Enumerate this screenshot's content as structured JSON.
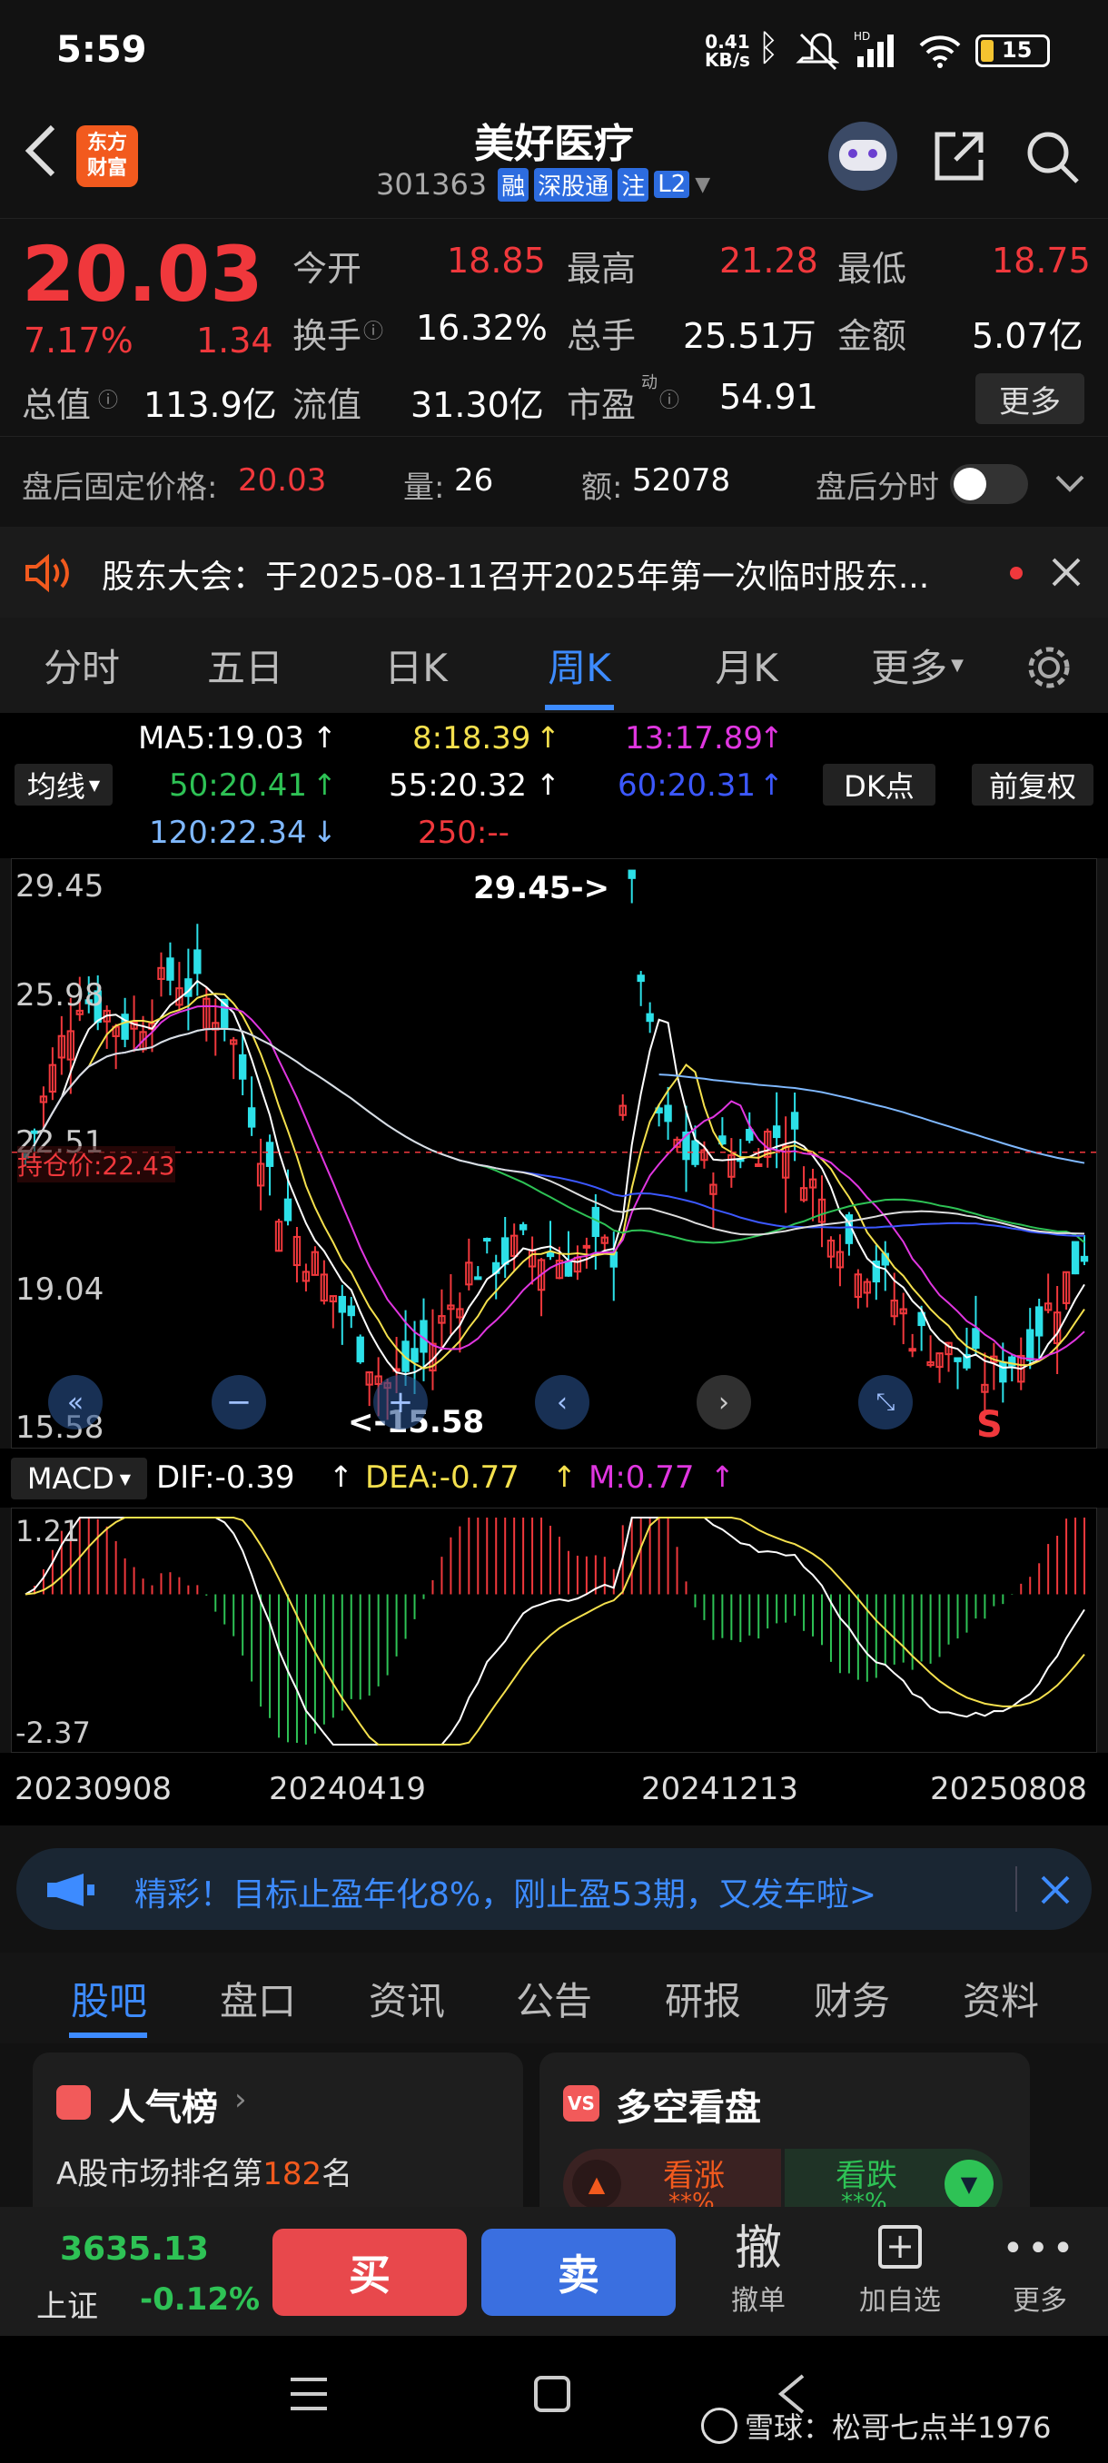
{
  "status": {
    "time": "5:59",
    "net_speed_top": "0.41",
    "net_speed_unit": "KB/s",
    "battery": "15"
  },
  "header": {
    "logo_line1": "东方",
    "logo_line2": "财富",
    "name": "美好医疗",
    "code": "301363",
    "tags": [
      "融",
      "深股通",
      "注",
      "L2"
    ]
  },
  "quote": {
    "price": "20.03",
    "pct": "7.17%",
    "change": "1.34",
    "rows": [
      [
        {
          "label": "今开",
          "value": "18.85",
          "color": "red"
        },
        {
          "label": "最高",
          "value": "21.28",
          "color": "red"
        },
        {
          "label": "最低",
          "value": "18.75",
          "color": "red"
        }
      ],
      [
        {
          "label": "换手",
          "value": "16.32%",
          "color": "white"
        },
        {
          "label": "总手",
          "value": "25.51万",
          "color": "white"
        },
        {
          "label": "金额",
          "value": "5.07亿",
          "color": "white"
        }
      ],
      [
        {
          "label": "总值",
          "value": "113.9亿",
          "color": "white"
        },
        {
          "label": "流值",
          "value": "31.30亿",
          "color": "white"
        },
        {
          "label": "市盈",
          "value": "54.91",
          "color": "white"
        }
      ]
    ],
    "more": "更多",
    "pe_superscript": "动"
  },
  "afterhours": {
    "fixed_label": "盘后固定价格:",
    "fixed_value": "20.03",
    "vol_label": "量:",
    "vol_value": "26",
    "amt_label": "额:",
    "amt_value": "52078",
    "toggle_label": "盘后分时"
  },
  "notice": {
    "text": "股东大会：于2025-08-11召开2025年第一次临时股东..."
  },
  "tabs": [
    "分时",
    "五日",
    "日K",
    "周K",
    "月K",
    "更多"
  ],
  "active_tab": 3,
  "ma": {
    "ma5": "MA5:19.03",
    "ma8": "8:18.39",
    "ma13": "13:17.89",
    "ma50": "50:20.41",
    "ma55": "55:20.32",
    "ma60": "60:20.31",
    "ma120": "120:22.34",
    "ma250": "250:--",
    "ind_select": "均线",
    "dk": "DK点",
    "fq": "前复权"
  },
  "chart": {
    "y_labels": [
      "29.45",
      "25.98",
      "22.51",
      "19.04",
      "15.58"
    ],
    "high_note": "29.45->",
    "low_note": "<-15.58",
    "cost_label": "持仓价:22.43",
    "sell_mark": "S"
  },
  "macd": {
    "label": "MACD",
    "dif": "DIF:-0.39",
    "dea": "DEA:-0.77",
    "m": "M:0.77",
    "top": "1.21",
    "bottom": "-2.37"
  },
  "dates": [
    "20230908",
    "20240419",
    "20241213",
    "20250808"
  ],
  "ad": {
    "text": "精彩！目标止盈年化8%，刚止盈53期，又发车啦>"
  },
  "bottom_tabs": [
    "股吧",
    "盘口",
    "资讯",
    "公告",
    "研报",
    "财务",
    "资料"
  ],
  "cards": {
    "left_title": "人气榜",
    "left_text_pre": "A股市场排名第",
    "left_rank": "182",
    "left_text_post": "名",
    "right_title": "多空看盘",
    "up_label": "看涨",
    "down_label": "看跌",
    "up_pct": "**%",
    "down_pct": "**%"
  },
  "action": {
    "index_value": "3635.13",
    "index_name": "上证",
    "index_pct": "-0.12%",
    "buy": "买",
    "sell": "卖",
    "cancel_icon_char": "撤",
    "cancel": "撤单",
    "add": "加自选",
    "more": "更多"
  },
  "watermark": "雪球：松哥七点半1976",
  "chart_data": {
    "type": "line",
    "x": [
      "20230908",
      "20240419",
      "20241213",
      "20250808"
    ],
    "y_range": [
      15.58,
      29.45
    ],
    "series": [
      {
        "name": "MA5",
        "last": 19.03
      },
      {
        "name": "MA8",
        "last": 18.39
      },
      {
        "name": "MA13",
        "last": 17.89
      },
      {
        "name": "MA50",
        "last": 20.41
      },
      {
        "name": "MA55",
        "last": 20.32
      },
      {
        "name": "MA60",
        "last": 20.31
      },
      {
        "name": "MA120",
        "last": 22.34
      }
    ],
    "colors": {
      "up": "#f0383c",
      "down": "#2ce0e8"
    }
  }
}
